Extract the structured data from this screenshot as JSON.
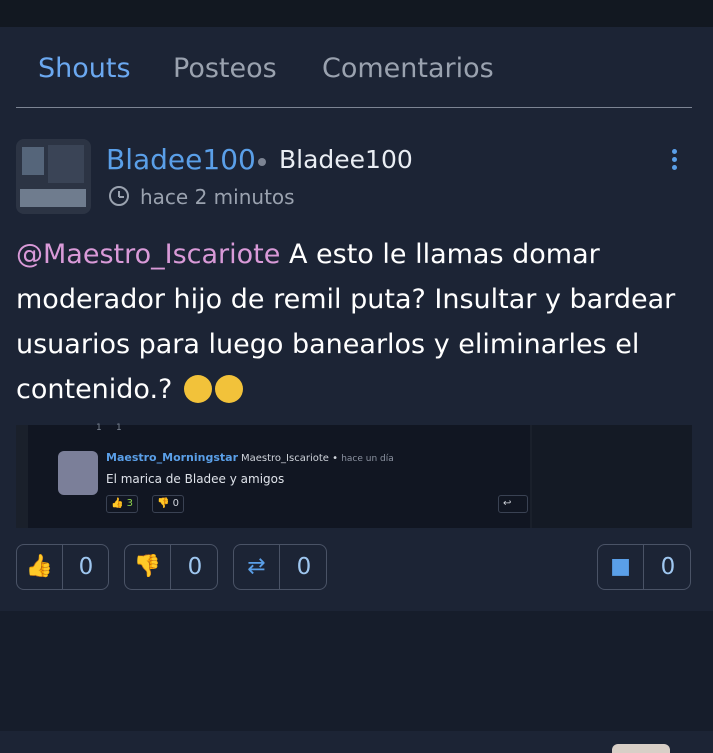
{
  "tabs": [
    {
      "label": "Shouts",
      "active": true
    },
    {
      "label": "Posteos",
      "active": false
    },
    {
      "label": "Comentarios",
      "active": false
    }
  ],
  "post": {
    "username": "Bladee100",
    "handle": "Bladee100",
    "time": "hace 2 minutos",
    "mention": "@Maestro_Iscariote",
    "text": " A esto le llamas domar moderador hijo de remil puta? Insultar y bardear usuarios para luego banearlos y eliminarles el contenido.? ",
    "emojis": [
      "smirk",
      "rofl"
    ]
  },
  "embed": {
    "top_counts": [
      "1",
      "1"
    ],
    "name": "Maestro_Morningstar",
    "handle": "Maestro_Iscariote",
    "time": "hace un día",
    "text": "El marica de Bladee y amigos",
    "likes": "3",
    "dislikes": "0"
  },
  "actions": {
    "like_count": "0",
    "dislike_count": "0",
    "repost_count": "0",
    "comment_count": "0"
  },
  "colors": {
    "accent": "#5a9fe8",
    "mention": "#d99ad8",
    "background": "#1c2435"
  }
}
